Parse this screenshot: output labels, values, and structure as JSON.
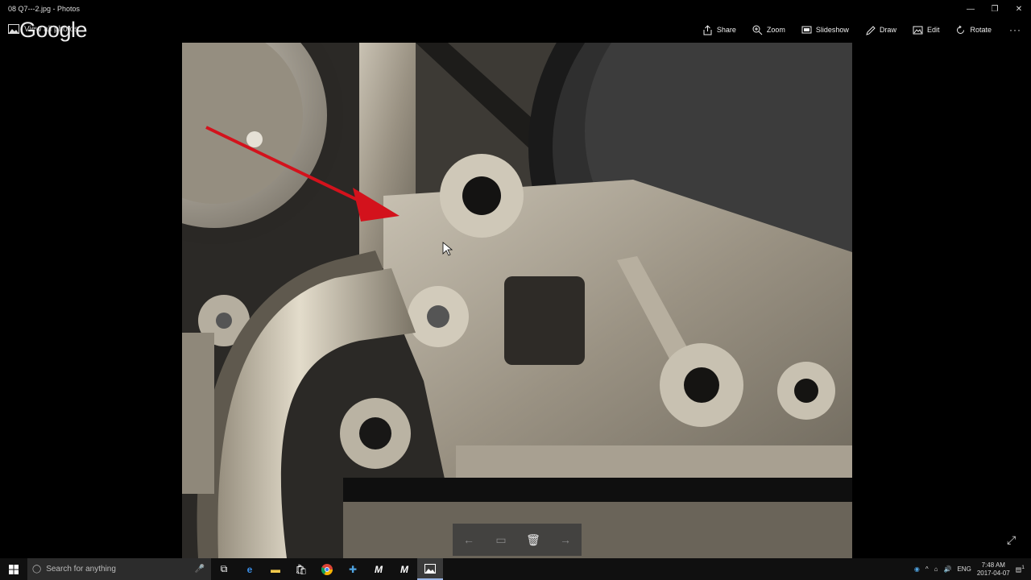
{
  "window": {
    "title": "08 Q7---2.jpg - Photos",
    "minimize": "—",
    "restore": "❐",
    "close": "✕"
  },
  "toolbar": {
    "view_all": "View all photos",
    "watermark": "Google",
    "actions": [
      {
        "id": "share",
        "label": "Share"
      },
      {
        "id": "zoom",
        "label": "Zoom"
      },
      {
        "id": "slideshow",
        "label": "Slideshow"
      },
      {
        "id": "draw",
        "label": "Draw"
      },
      {
        "id": "edit",
        "label": "Edit"
      },
      {
        "id": "rotate",
        "label": "Rotate"
      }
    ],
    "more": "···"
  },
  "strip": {
    "prev": "←",
    "trash": "🗑",
    "next": "→"
  },
  "taskbar": {
    "search_placeholder": "Search for anything",
    "language": "ENG",
    "time": "7:48 AM",
    "date": "2017-04-07",
    "notification_count": "1"
  },
  "colors": {
    "arrow": "#d3121c",
    "taskbar": "#101010",
    "accent": "#9bb7e6"
  }
}
